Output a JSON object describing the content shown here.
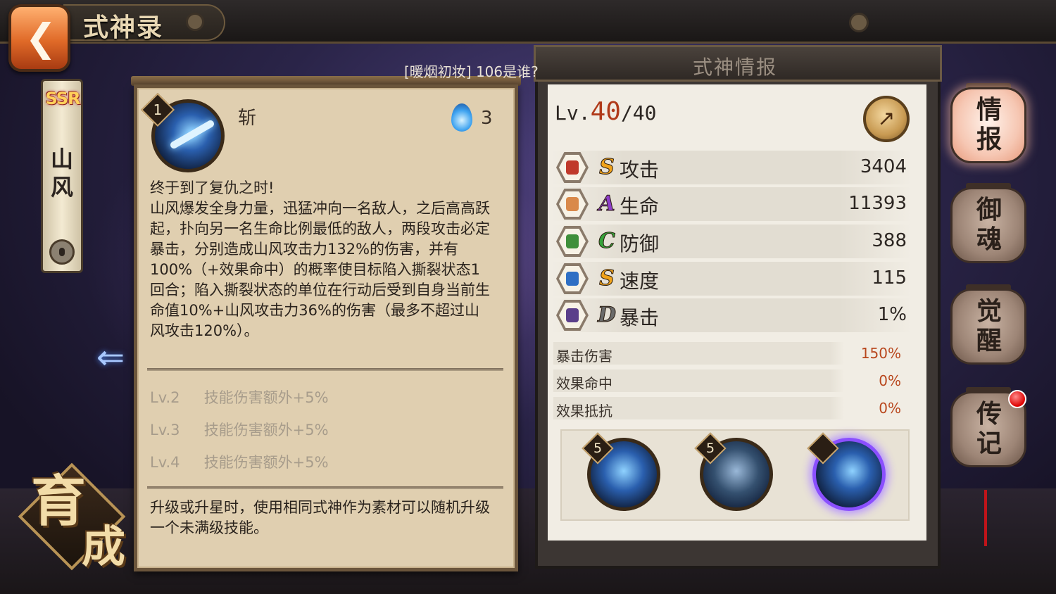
{
  "header": {
    "title": "式神录",
    "back_icon": "back-arrow-icon"
  },
  "shikigami": {
    "rarity": "SSR",
    "name": "山风"
  },
  "marquee": "[暖烟初妆] 106是谁?",
  "skill": {
    "level_badge": "1",
    "name": "斩",
    "orb_cost": "3",
    "description": "终于到了复仇之时!\n山风爆发全身力量，迅猛冲向一名敌人，之后高高跃起，扑向另一名生命比例最低的敌人，两段攻击必定暴击，分别造成山风攻击力132%的伤害，并有100%（+效果命中）的概率使目标陷入撕裂状态1回合；陷入撕裂状态的单位在行动后受到自身当前生命值10%+山风攻击力36%的伤害（最多不超过山风攻击120%）。",
    "upgrades": [
      {
        "level": "Lv.2",
        "text": "技能伤害额外+5%"
      },
      {
        "level": "Lv.3",
        "text": "技能伤害额外+5%"
      },
      {
        "level": "Lv.4",
        "text": "技能伤害额外+5%"
      }
    ],
    "note": "升级或升星时，使用相同式神作为素材可以随机升级一个未满级技能。"
  },
  "info": {
    "header_title": "式神情报",
    "level_prefix": "Lv.",
    "level_current": "40",
    "level_max": "/40",
    "stats": [
      {
        "grade": "S",
        "name": "攻击",
        "value": "3404",
        "icon": "fan-icon",
        "grade_color": "#f0a21a",
        "icon_color": "#c0392b"
      },
      {
        "grade": "A",
        "name": "生命",
        "value": "11393",
        "icon": "scroll-icon",
        "grade_color": "#8e3ec9",
        "icon_color": "#d9894a"
      },
      {
        "grade": "C",
        "name": "防御",
        "value": "388",
        "icon": "helmet-icon",
        "grade_color": "#36a23a",
        "icon_color": "#3f8f3a"
      },
      {
        "grade": "S",
        "name": "速度",
        "value": "115",
        "icon": "boot-icon",
        "grade_color": "#f0a21a",
        "icon_color": "#2f6fc4"
      },
      {
        "grade": "D",
        "name": "暴击",
        "value": "1%",
        "icon": "talisman-icon",
        "grade_color": "#6a6a6a",
        "icon_color": "#5b3f8a"
      }
    ],
    "sub_stats": [
      {
        "name": "暴击伤害",
        "value": "150%"
      },
      {
        "name": "效果命中",
        "value": "0%"
      },
      {
        "name": "效果抵抗",
        "value": "0%"
      }
    ],
    "skill_slots": [
      {
        "badge": "5",
        "selected": false
      },
      {
        "badge": "5",
        "selected": false
      },
      {
        "badge": "",
        "selected": true
      }
    ]
  },
  "tabs": [
    {
      "label": "情\n报",
      "active": true
    },
    {
      "label": "御\n魂",
      "active": false
    },
    {
      "label": "觉\n醒",
      "active": false
    },
    {
      "label": "传\n记",
      "active": false
    }
  ],
  "nurture": {
    "char1": "育",
    "char2": "成"
  }
}
